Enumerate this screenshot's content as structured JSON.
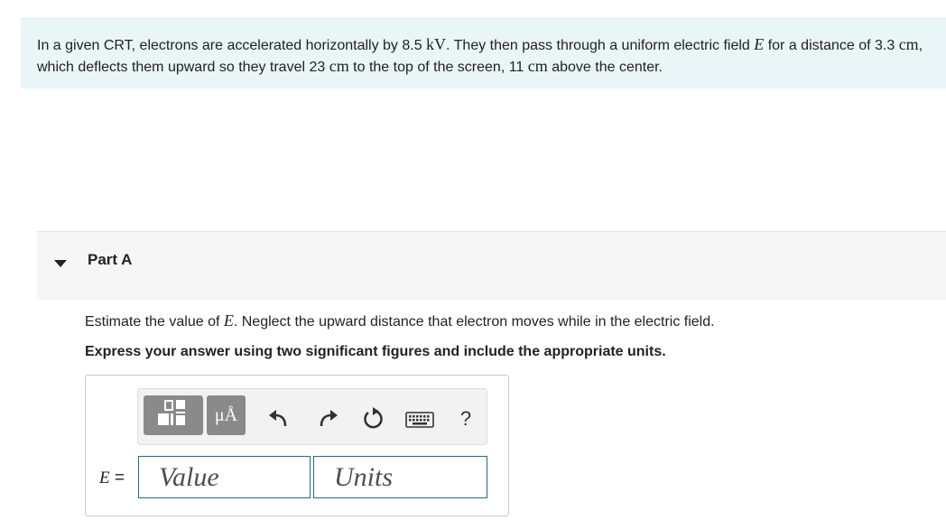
{
  "intro": {
    "t1": "In a given CRT, electrons are accelerated horizontally by 8.5 ",
    "u1": "kV",
    "t2": ". They then pass through a uniform electric field ",
    "v1": "E",
    "t3": " for a distance of 3.3 ",
    "u2": "cm",
    "t4": ", which deflects them upward so they travel 23 ",
    "u3": "cm",
    "t5": " to the top of the screen, 11 ",
    "u4": "cm",
    "t6": " above the center."
  },
  "part": {
    "title": "Part A",
    "toggle_icon": "triangle-down-icon"
  },
  "question": {
    "q1": "Estimate the value of ",
    "qvar": "E",
    "q2": ". Neglect the upward distance that electron moves while in the electric field.",
    "instruction": "Express your answer using two significant figures and include the appropriate units."
  },
  "toolbar": {
    "templates_icon": "templates-icon",
    "units_label": "μÅ",
    "undo_icon": "undo-icon",
    "redo_icon": "redo-icon",
    "reset_icon": "reset-icon",
    "keyboard_icon": "keyboard-icon",
    "help_label": "?"
  },
  "answer": {
    "var_label": "E",
    "equals": " =",
    "value_placeholder": "Value",
    "units_placeholder": "Units"
  },
  "colors": {
    "intro_bg": "#eaf5f8",
    "part_bg": "#f6f6f6",
    "field_border": "#2b6a80",
    "toolbar_button": "#8a8a8a"
  }
}
